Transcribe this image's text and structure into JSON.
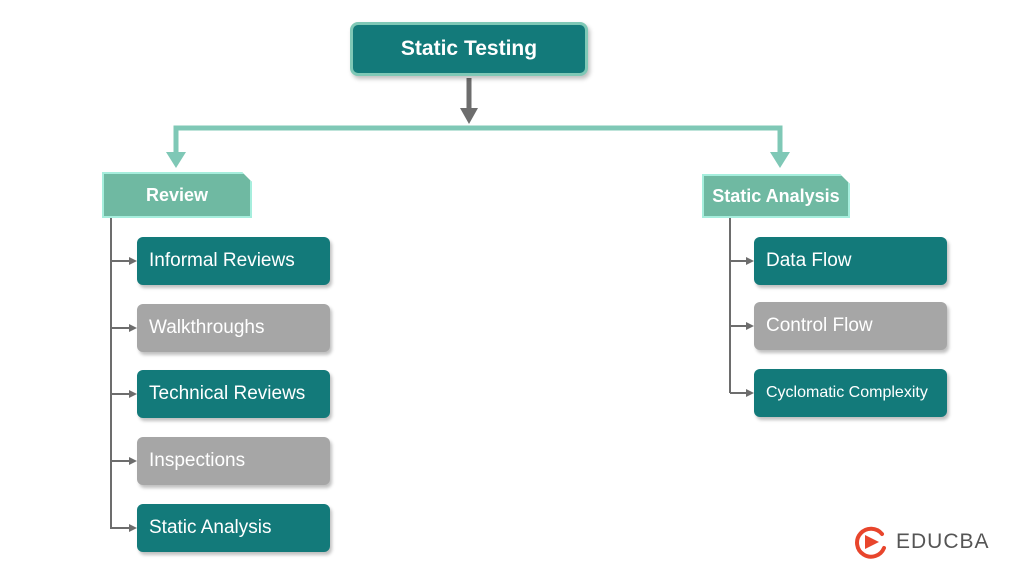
{
  "root": {
    "label": "Static Testing"
  },
  "branches": [
    {
      "label": "Review",
      "children": [
        {
          "label": "Informal Reviews",
          "style": "teal"
        },
        {
          "label": "Walkthroughs",
          "style": "grey"
        },
        {
          "label": "Technical Reviews",
          "style": "teal"
        },
        {
          "label": "Inspections",
          "style": "grey"
        },
        {
          "label": "Static Analysis",
          "style": "teal"
        }
      ]
    },
    {
      "label": "Static Analysis",
      "children": [
        {
          "label": "Data Flow",
          "style": "teal"
        },
        {
          "label": "Control Flow",
          "style": "grey"
        },
        {
          "label": "Cyclomatic Complexity",
          "style": "teal"
        }
      ]
    }
  ],
  "brand": {
    "name": "EDUCBA",
    "color": "#e8452c"
  },
  "colors": {
    "teal": "#137a7a",
    "grey": "#a6a6a6",
    "mint": "#6fb9a2",
    "connector": "#7fc8b6",
    "arrow": "#6d6d6d"
  }
}
